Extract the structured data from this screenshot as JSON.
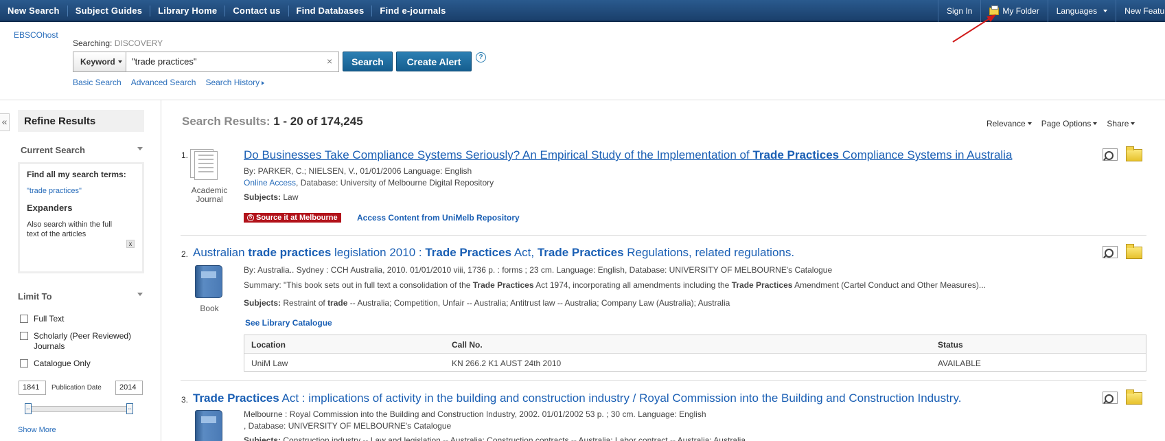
{
  "topnav": {
    "left": [
      "New Search",
      "Subject Guides",
      "Library Home",
      "Contact us",
      "Find Databases",
      "Find e-journals"
    ],
    "sign_in": "Sign In",
    "my_folder": "My Folder",
    "languages": "Languages",
    "new_features": "New Featu"
  },
  "header": {
    "brand": "EBSCOhost",
    "searching_label": "Searching:",
    "searching_db": "DISCOVERY",
    "field_select": "Keyword",
    "query": "\"trade practices\"",
    "search_btn": "Search",
    "alert_btn": "Create Alert",
    "help": "?",
    "links": [
      "Basic Search",
      "Advanced Search",
      "Search History"
    ]
  },
  "sidebar": {
    "collapse": "«",
    "title": "Refine Results",
    "current_search": {
      "heading": "Current Search",
      "find_all": "Find all my search terms:",
      "term": "\"trade practices\"",
      "expanders": "Expanders",
      "expander_text": "Also search within the full text of the articles",
      "remove": "x"
    },
    "limit_to": {
      "heading": "Limit To",
      "options": [
        "Full Text",
        "Scholarly (Peer Reviewed) Journals",
        "Catalogue Only"
      ],
      "year_from": "1841",
      "year_to": "2014",
      "pub_date_label": "Publication Date",
      "show_more": "Show More"
    }
  },
  "results": {
    "label": "Search Results:",
    "range": "1 - 20 of 174,245",
    "sort": [
      "Relevance",
      "Page Options",
      "Share"
    ],
    "items": [
      {
        "num": "1.",
        "title_parts": [
          "Do Businesses Take Compliance Systems Seriously? An Empirical Study of the Implementation of ",
          "Trade Practices",
          " Compliance Systems in Australia"
        ],
        "type": "Academic Journal",
        "byline": "By: PARKER, C.; NIELSEN, V., 01/01/2006 Language: English",
        "access_link": "Online Access",
        "access_rest": ", Database: University of Melbourne Digital Repository",
        "subjects_label": "Subjects:",
        "subjects": "Law",
        "badge": "Source it at Melbourne",
        "access_content": "Access Content from UniMelb Repository"
      },
      {
        "num": "2.",
        "title_parts": [
          "Australian ",
          "trade practices",
          " legislation 2010 : ",
          "Trade Practices",
          " Act, ",
          "Trade Practices",
          " Regulations, related regulations."
        ],
        "type": "Book",
        "byline": "By: Australia.. Sydney : CCH Australia, 2010. 01/01/2010 viii, 1736 p. : forms ; 23 cm. Language: English, Database: UNIVERSITY OF MELBOURNE's Catalogue",
        "summary_parts": [
          "Summary: \"This book sets out in full text a consolidation of the ",
          "Trade Practices",
          " Act 1974, incorporating all amendments including the ",
          "Trade Practices",
          " Amendment (Cartel Conduct and Other Measures)..."
        ],
        "subjects_label": "Subjects:",
        "subjects_parts": [
          "Restraint of ",
          "trade",
          " -- Australia; Competition, Unfair -- Australia; Antitrust law -- Australia; Company Law (Australia); Australia"
        ],
        "catalogue_link": "See Library Catalogue",
        "holdings_head": [
          "Location",
          "Call No.",
          "Status"
        ],
        "holdings_row": [
          "UniM Law",
          "KN 266.2 K1 AUST 24th 2010",
          "AVAILABLE"
        ]
      },
      {
        "num": "3.",
        "title_parts": [
          "Trade Practices",
          " Act : implications of activity in the building and construction industry / Royal Commission into the Building and Construction Industry."
        ],
        "byline": "Melbourne : Royal Commission into the Building and Construction Industry, 2002. 01/01/2002 53 p. ; 30 cm. Language: English",
        "db_line": ", Database: UNIVERSITY OF MELBOURNE's Catalogue",
        "subjects_label": "Subjects:",
        "subjects": "Construction industry -- Law and legislation -- Australia; Construction contracts -- Australia; Labor contract -- Australia; Australia"
      }
    ]
  },
  "colors": {
    "nav_bg": "#1a3f6b",
    "link": "#1a5fb4",
    "button": "#155e8f",
    "badge": "#b2121a",
    "annotation_arrow": "#d01a1a"
  }
}
